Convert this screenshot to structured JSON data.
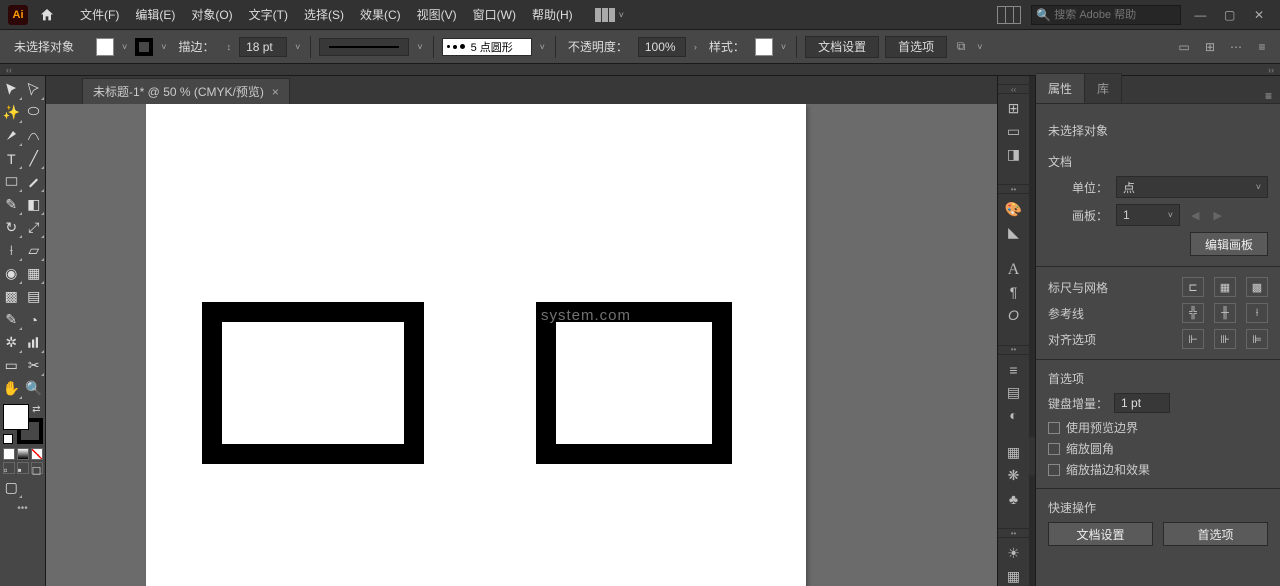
{
  "app": {
    "logo": "Ai"
  },
  "menu": {
    "file": "文件(F)",
    "edit": "编辑(E)",
    "object": "对象(O)",
    "type": "文字(T)",
    "select": "选择(S)",
    "effect": "效果(C)",
    "view": "视图(V)",
    "window": "窗口(W)",
    "help": "帮助(H)"
  },
  "search": {
    "placeholder": "搜索 Adobe 帮助"
  },
  "control": {
    "no_selection": "未选择对象",
    "stroke_label": "描边：",
    "stroke_weight": "18 pt",
    "brush_label": "5 点圆形",
    "opacity_label": "不透明度：",
    "opacity_value": "100%",
    "style_label": "样式：",
    "doc_setup": "文档设置",
    "preferences": "首选项"
  },
  "doc": {
    "tab_title": "未标题-1* @ 50 % (CMYK/预览)",
    "watermark": "system.com"
  },
  "panel": {
    "tabs": {
      "properties": "属性",
      "library": "库"
    },
    "no_selection": "未选择对象",
    "document_section": "文档",
    "units_label": "单位：",
    "units_value": "点",
    "artboard_label": "画板：",
    "artboard_value": "1",
    "edit_artboards": "编辑画板",
    "rulers_grid": "标尺与网格",
    "guides": "参考线",
    "align_options": "对齐选项",
    "preferences": "首选项",
    "key_increment": "键盘增量：",
    "key_value": "1 pt",
    "use_preview_bounds": "使用预览边界",
    "scale_corners": "缩放圆角",
    "scale_strokes": "缩放描边和效果",
    "quick_actions": "快速操作",
    "qa_doc_setup": "文档设置",
    "qa_prefs": "首选项"
  }
}
